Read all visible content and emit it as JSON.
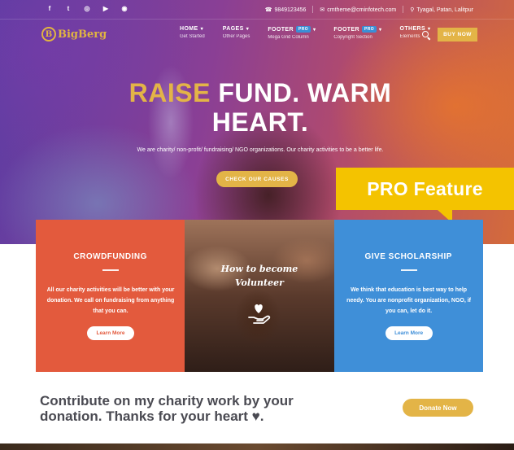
{
  "topbar": {
    "social": [
      "f",
      "t",
      "ig",
      "yt",
      "dr"
    ],
    "phone": "9849123456",
    "email": "cmtheme@cminfotech.com",
    "location": "Tyagal, Patan, Lalitpur"
  },
  "brand": {
    "logo_mark": "B",
    "logo_text": "BigBerg"
  },
  "nav": {
    "items": [
      {
        "label": "HOME",
        "sub": "Get Started"
      },
      {
        "label": "PAGES",
        "sub": "Other Pages"
      },
      {
        "label": "FOOTER",
        "badge": "PRO",
        "sub": "Mega Grid Column"
      },
      {
        "label": "FOOTER",
        "badge": "PRO",
        "sub": "Copyright Section"
      },
      {
        "label": "OTHERS",
        "sub": "Elements"
      }
    ],
    "buy_label": "BUY NOW"
  },
  "hero": {
    "headline_gold": "RAISE",
    "headline_rest_1": "FUND. WARM",
    "headline_rest_2": "HEART.",
    "subtext": "We are charity/ non-profit/ fundraising/ NGO organizations. Our charity activities to be a better life.",
    "cta_label": "CHECK OUR CAUSES"
  },
  "pro_feature": "PRO Feature",
  "cards": [
    {
      "title": "CROWDFUNDING",
      "text": "All our charity activities will be better with your donation. We call on fundraising from anything that you can.",
      "button": "Learn More"
    },
    {
      "title_line1": "How to become",
      "title_line2": "Volunteer"
    },
    {
      "title": "GIVE SCHOLARSHIP",
      "text": "We think that education is best way to help needy. You are nonprofit organization, NGO, if you can, let do it.",
      "button": "Learn More"
    }
  ],
  "donate": {
    "text": "Contribute on my charity work by your donation. Thanks for your heart ♥.",
    "button": "Donate Now"
  },
  "colors": {
    "gold": "#e3b447",
    "red": "#e35a3d",
    "blue": "#3f8fd8",
    "pro_yellow": "#f4c300"
  }
}
